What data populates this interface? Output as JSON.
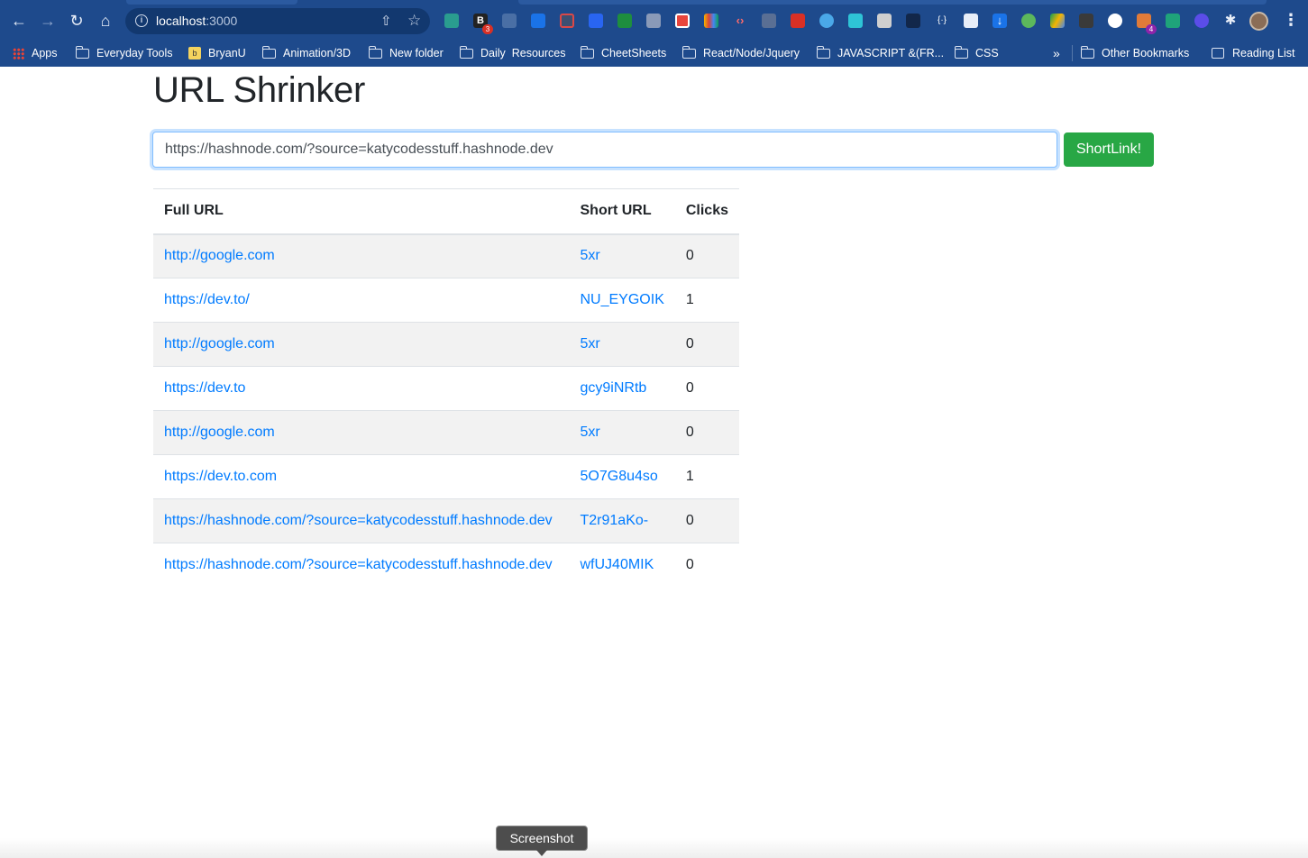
{
  "browser": {
    "url_host": "localhost",
    "url_port": ":3000",
    "bookmarks": [
      {
        "label": "Apps",
        "icon": "apps-grid-icon"
      },
      {
        "label": "Everyday Tools",
        "icon": "folder-icon"
      },
      {
        "label": "BryanU",
        "icon": "bryanu-favicon"
      },
      {
        "label": "Animation/3D",
        "icon": "folder-icon"
      },
      {
        "label": "New folder",
        "icon": "folder-icon"
      },
      {
        "label": "Daily  Resources",
        "icon": "folder-icon"
      },
      {
        "label": "CheetSheets",
        "icon": "folder-icon"
      },
      {
        "label": "React/Node/Jquery",
        "icon": "folder-icon"
      },
      {
        "label": "JAVASCRIPT &(FR...",
        "icon": "folder-icon"
      },
      {
        "label": "CSS",
        "icon": "folder-icon"
      }
    ],
    "overflow_label": "»",
    "other_bookmarks": "Other Bookmarks",
    "reading_list": "Reading List",
    "extension_badges": [
      "3",
      "4"
    ],
    "bryanu_glyph": "B"
  },
  "page": {
    "title": "URL Shrinker",
    "input_value": "https://hashnode.com/?source=katycodesstuff.hashnode.dev",
    "submit_label": "ShortLink!"
  },
  "table": {
    "headers": [
      "Full URL",
      "Short URL",
      "Clicks"
    ],
    "rows": [
      {
        "full": "http://google.com",
        "short": "5xr",
        "clicks": "0"
      },
      {
        "full": "https://dev.to/",
        "short": "NU_EYGOIK",
        "clicks": "1"
      },
      {
        "full": "http://google.com",
        "short": "5xr",
        "clicks": "0"
      },
      {
        "full": "https://dev.to",
        "short": "gcy9iNRtb",
        "clicks": "0"
      },
      {
        "full": "http://google.com",
        "short": "5xr",
        "clicks": "0"
      },
      {
        "full": "https://dev.to.com",
        "short": "5O7G8u4so",
        "clicks": "1"
      },
      {
        "full": "https://hashnode.com/?source=katycodesstuff.hashnode.dev",
        "short": "T2r91aKo-",
        "clicks": "0"
      },
      {
        "full": "https://hashnode.com/?source=katycodesstuff.hashnode.dev",
        "short": "wfUJ40MIK",
        "clicks": "0"
      }
    ]
  },
  "tooltip": {
    "label": "Screenshot"
  },
  "colors": {
    "chrome_bg": "#1e4a8c",
    "link": "#007bff",
    "button": "#28a745",
    "stripe": "#f2f2f2"
  }
}
